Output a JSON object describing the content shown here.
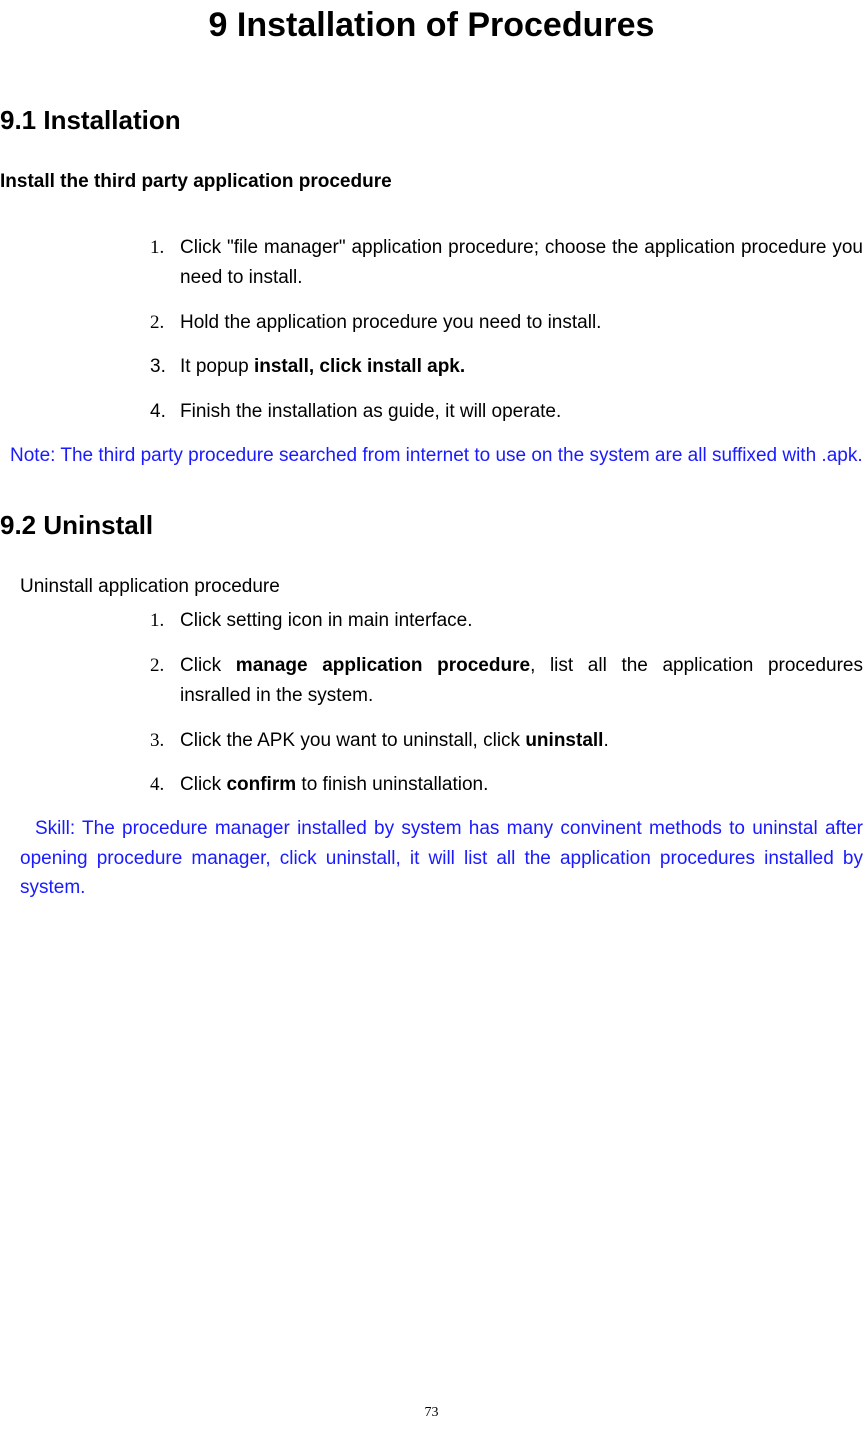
{
  "chapter_title": "9 Installation of Procedures",
  "section_91": {
    "title": "9.1 Installation",
    "subtitle": "Install the third party application procedure",
    "items": [
      {
        "marker": "1.",
        "pre": "Click \"file manager\" application procedure; choose the application procedure you need to install."
      },
      {
        "marker": "2.",
        "pre": "Hold the application procedure you need to install."
      },
      {
        "marker": "3.",
        "pre": "It popup ",
        "bold": "install, click install apk."
      },
      {
        "marker": "4.",
        "pre": "Finish the installation as guide, it will operate."
      }
    ],
    "note": "Note: The third party procedure searched from internet to use on the system are all suffixed with .apk."
  },
  "section_92": {
    "title": "9.2 Uninstall",
    "intro": "Uninstall application procedure",
    "items": [
      {
        "marker": "1.",
        "pre": "Click setting icon in main interface."
      },
      {
        "marker": "2.",
        "pre": "Click ",
        "bold": "manage application procedure",
        "post": ", list all the application procedures insralled in the system."
      },
      {
        "marker": "3.",
        "pre": "Click the APK you want to uninstall, click ",
        "bold": "uninstall",
        "post": "."
      },
      {
        "marker": "4.",
        "pre": "Click ",
        "bold": "confirm",
        "post": " to finish uninstallation."
      }
    ],
    "skill": "Skill: The procedure manager installed by system has many convinent methods to uninstal after opening procedure manager, click uninstall, it will list all the application procedures installed by system."
  },
  "page_number": "73"
}
